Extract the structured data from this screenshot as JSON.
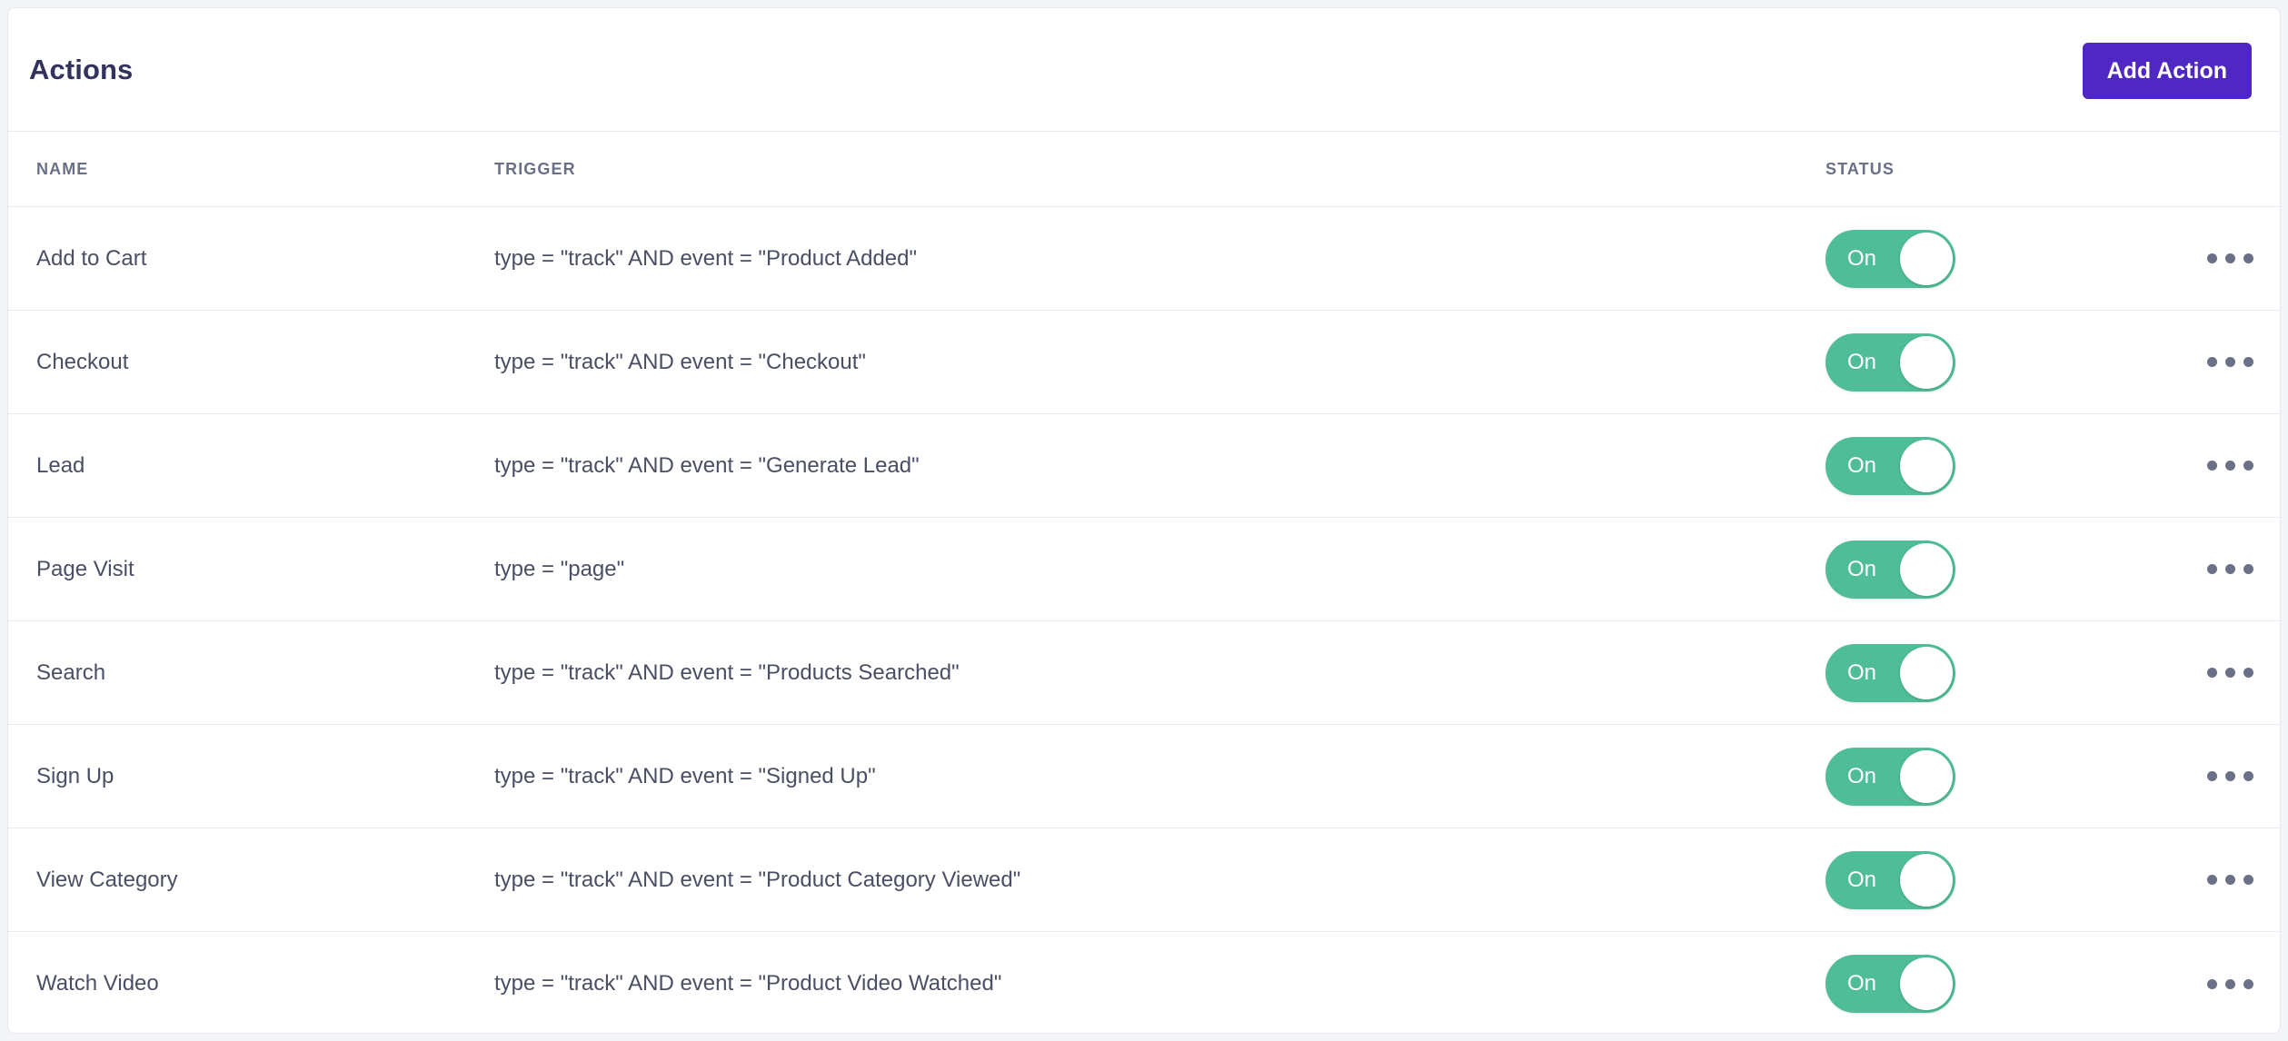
{
  "page": {
    "background_color": "#F4F5F8",
    "card_background": "#FFFFFF"
  },
  "header": {
    "title": "Actions",
    "add_button_label": "Add Action",
    "add_button_color": "#4F28C4"
  },
  "table": {
    "columns": [
      {
        "key": "name",
        "label": "NAME"
      },
      {
        "key": "trigger",
        "label": "TRIGGER"
      },
      {
        "key": "status",
        "label": "STATUS"
      }
    ],
    "toggle_on_label": "On",
    "toggle_on_color": "#4FBE98",
    "menu_icon": "kebab-menu-icon",
    "rows": [
      {
        "name": "Add to Cart",
        "trigger": "type = \"track\" AND event = \"Product Added\"",
        "status": "On"
      },
      {
        "name": "Checkout",
        "trigger": "type = \"track\" AND event = \"Checkout\"",
        "status": "On"
      },
      {
        "name": "Lead",
        "trigger": "type = \"track\" AND event = \"Generate Lead\"",
        "status": "On"
      },
      {
        "name": "Page Visit",
        "trigger": "type = \"page\"",
        "status": "On"
      },
      {
        "name": "Search",
        "trigger": "type = \"track\" AND event = \"Products Searched\"",
        "status": "On"
      },
      {
        "name": "Sign Up",
        "trigger": "type = \"track\" AND event = \"Signed Up\"",
        "status": "On"
      },
      {
        "name": "View Category",
        "trigger": "type = \"track\" AND event = \"Product Category Viewed\"",
        "status": "On"
      },
      {
        "name": "Watch Video",
        "trigger": "type = \"track\" AND event = \"Product Video Watched\"",
        "status": "On"
      }
    ]
  }
}
